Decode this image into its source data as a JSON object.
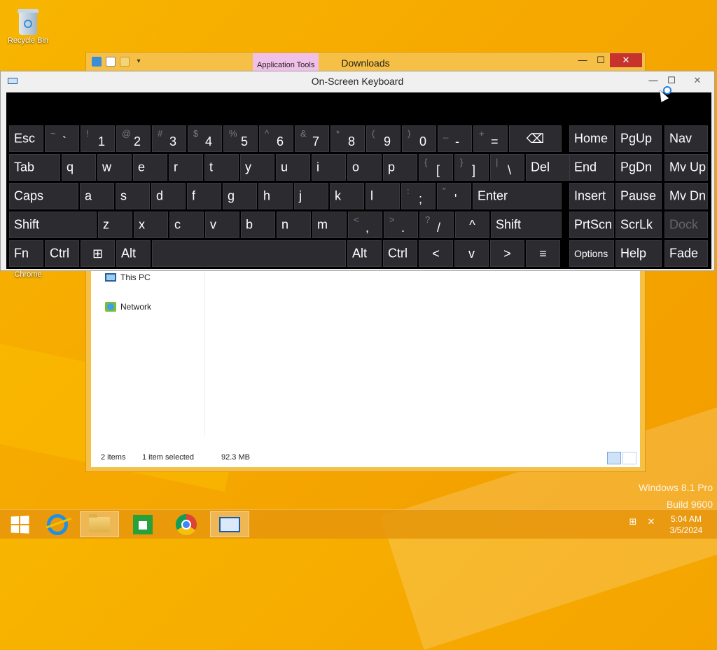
{
  "desktop": {
    "icons": [
      {
        "label": "Recycle Bin",
        "icon": "recycle-bin-icon"
      }
    ],
    "partial_label": "Chrome"
  },
  "explorer": {
    "title": "Downloads",
    "contextual_tab": "Application Tools",
    "controls": {
      "minimize": "—",
      "maximize": "☐",
      "close": "✕"
    },
    "nav_items": [
      {
        "label": "This PC",
        "icon": "this-pc-icon"
      },
      {
        "label": "Network",
        "icon": "network-icon"
      }
    ],
    "status": {
      "items": "2 items",
      "selected": "1 item selected",
      "size": "92.3 MB"
    },
    "accent": "#f6c046"
  },
  "osk": {
    "title": "On-Screen Keyboard",
    "controls": {
      "minimize": "—",
      "maximize": "☐",
      "close": "✕"
    },
    "rows": {
      "r1": [
        {
          "main": "Esc"
        },
        {
          "sub": "~",
          "main": "`"
        },
        {
          "sub": "!",
          "main": "1"
        },
        {
          "sub": "@",
          "main": "2"
        },
        {
          "sub": "#",
          "main": "3"
        },
        {
          "sub": "$",
          "main": "4"
        },
        {
          "sub": "%",
          "main": "5"
        },
        {
          "sub": "^",
          "main": "6"
        },
        {
          "sub": "&",
          "main": "7"
        },
        {
          "sub": "*",
          "main": "8"
        },
        {
          "sub": "(",
          "main": "9"
        },
        {
          "sub": ")",
          "main": "0"
        },
        {
          "sub": "_",
          "main": "-"
        },
        {
          "sub": "+",
          "main": "="
        },
        {
          "main": "⌫",
          "icon": "backspace-icon"
        }
      ],
      "r2": [
        {
          "main": "Tab"
        },
        {
          "main": "q"
        },
        {
          "main": "w"
        },
        {
          "main": "e"
        },
        {
          "main": "r"
        },
        {
          "main": "t"
        },
        {
          "main": "y"
        },
        {
          "main": "u"
        },
        {
          "main": "i"
        },
        {
          "main": "o"
        },
        {
          "main": "p"
        },
        {
          "sub": "{",
          "main": "["
        },
        {
          "sub": "}",
          "main": "]"
        },
        {
          "sub": "|",
          "main": "\\"
        },
        {
          "main": "Del"
        }
      ],
      "r3": [
        {
          "main": "Caps"
        },
        {
          "main": "a"
        },
        {
          "main": "s"
        },
        {
          "main": "d"
        },
        {
          "main": "f"
        },
        {
          "main": "g"
        },
        {
          "main": "h"
        },
        {
          "main": "j"
        },
        {
          "main": "k"
        },
        {
          "main": "l"
        },
        {
          "sub": ":",
          "main": ";"
        },
        {
          "sub": "\"",
          "main": "'"
        },
        {
          "main": "Enter"
        }
      ],
      "r4": [
        {
          "main": "Shift"
        },
        {
          "main": "z"
        },
        {
          "main": "x"
        },
        {
          "main": "c"
        },
        {
          "main": "v"
        },
        {
          "main": "b"
        },
        {
          "main": "n"
        },
        {
          "main": "m"
        },
        {
          "sub": "<",
          "main": ","
        },
        {
          "sub": ">",
          "main": "."
        },
        {
          "sub": "?",
          "main": "/"
        },
        {
          "main": "^",
          "icon": "arrow-up-icon"
        },
        {
          "main": "Shift"
        }
      ],
      "r5": [
        {
          "main": "Fn"
        },
        {
          "main": "Ctrl"
        },
        {
          "main": "⊞",
          "icon": "windows-logo-icon"
        },
        {
          "main": "Alt"
        },
        {
          "main": "",
          "icon": "spacebar"
        },
        {
          "main": "Alt"
        },
        {
          "main": "Ctrl"
        },
        {
          "main": "<",
          "icon": "arrow-left-icon"
        },
        {
          "main": "v",
          "icon": "arrow-down-icon"
        },
        {
          "main": ">",
          "icon": "arrow-right-icon"
        },
        {
          "main": "≡",
          "icon": "menu-key-icon"
        }
      ]
    },
    "side": [
      [
        "Home",
        "PgUp",
        "Nav"
      ],
      [
        "End",
        "PgDn",
        "Mv Up"
      ],
      [
        "Insert",
        "Pause",
        "Mv Dn"
      ],
      [
        "PrtScn",
        "ScrLk",
        "Dock"
      ],
      [
        "Options",
        "Help",
        "Fade"
      ]
    ]
  },
  "watermark": {
    "line1": "Windows 8.1 Pro",
    "line2": "Build 9600"
  },
  "taskbar": {
    "items": [
      "start-button",
      "internet-explorer",
      "file-explorer",
      "store",
      "chrome",
      "on-screen-keyboard"
    ],
    "time": "5:04 AM",
    "date": "3/5/2024"
  }
}
